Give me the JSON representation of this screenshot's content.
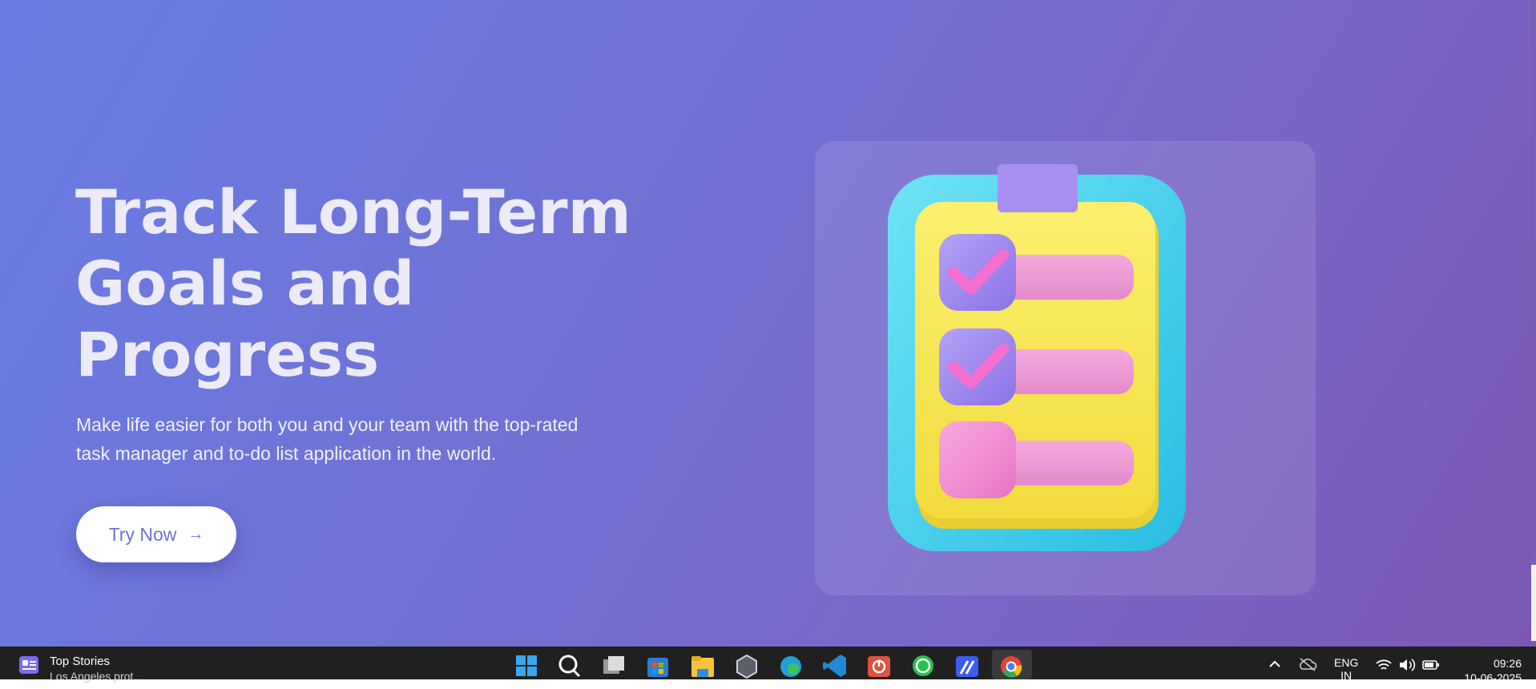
{
  "hero": {
    "title_line1": "Track Long-Term",
    "title_line2": "Goals and",
    "title_line3": "Progress",
    "subtitle_line1": "Make life easier for both you and your team with the top-rated",
    "subtitle_line2": "task manager and to-do list application in the world.",
    "cta_label": "Try Now",
    "cta_arrow": "→"
  },
  "illustration": {
    "icon": "clipboard-checklist-icon",
    "items": [
      {
        "checked": true
      },
      {
        "checked": true
      },
      {
        "checked": false
      }
    ]
  },
  "taskbar": {
    "widget_title": "Top Stories",
    "widget_subtitle": "Los Angeles prot...",
    "apps": [
      "start-icon",
      "search-icon",
      "task-view-icon",
      "store-icon",
      "file-explorer-icon",
      "app-cube-icon",
      "edge-icon",
      "vscode-icon",
      "app-red-icon",
      "whatsapp-icon",
      "app-blue-icon",
      "chrome-icon"
    ],
    "language_line1": "ENG",
    "language_line2": "IN",
    "time": "09:26",
    "date": "10-06-2025"
  },
  "colors": {
    "hero_gradient_start": "#6a7de6",
    "hero_gradient_end": "#7c58b4",
    "cta_text": "#6d72d8",
    "clipboard_frame": "#4ed6ee",
    "clipboard_paper": "#f7e85a",
    "checkbox_purple": "#a28cf0",
    "bar_pink": "#ee95d2"
  }
}
